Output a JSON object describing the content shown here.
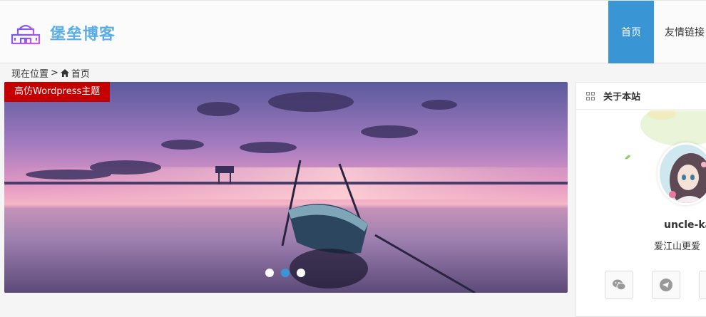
{
  "header": {
    "site_name": "堡垒博客",
    "logo_icon": "castle-icon",
    "nav": [
      {
        "label": "首页",
        "active": true
      },
      {
        "label": "友情链接",
        "active": false
      }
    ],
    "accent_color": "#3a95d4",
    "brand_color": "#5aaee8"
  },
  "breadcrumb": {
    "prefix": "现在位置",
    "separator": ">",
    "home_icon": "home-icon",
    "current": "首页"
  },
  "slider": {
    "tag": "高仿Wordpress主题",
    "tag_color": "#c40000",
    "slides": 3,
    "active_index": 1
  },
  "about": {
    "title": "关于本站",
    "title_icon": "grid-icon",
    "author": "uncle-ka",
    "motto": "爱江山更爱",
    "social": [
      {
        "icon": "wechat-icon"
      },
      {
        "icon": "telegram-icon"
      }
    ]
  }
}
